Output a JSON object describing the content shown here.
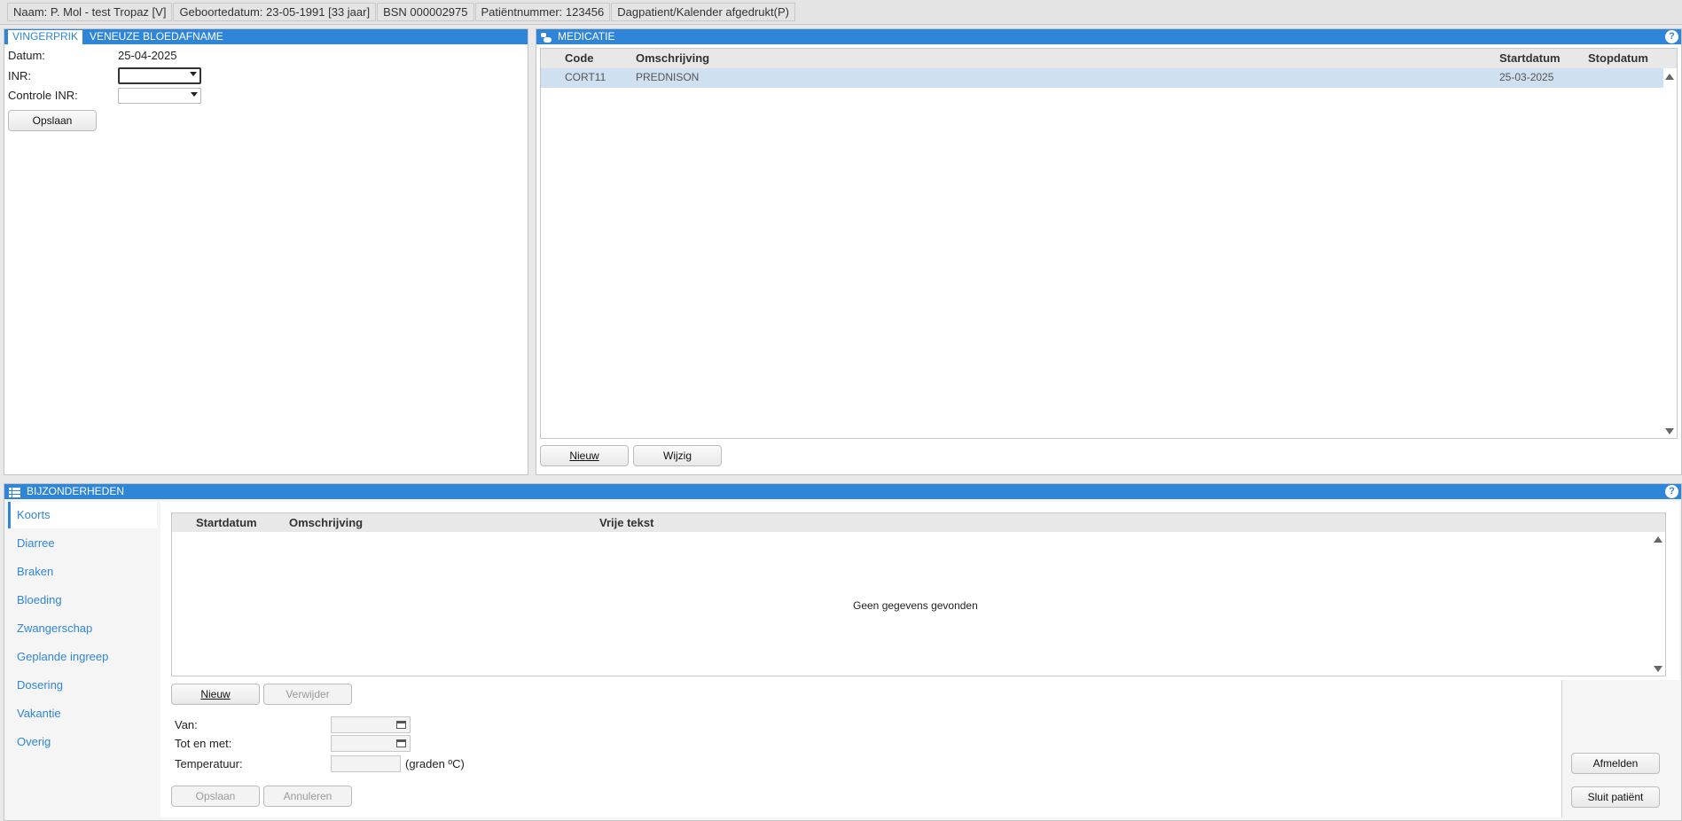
{
  "patient_bar": {
    "naam": "Naam: P. Mol - test Tropaz [V]",
    "geboortedatum": "Geboortedatum: 23-05-1991 [33 jaar]",
    "bsn": "BSN 000002975",
    "patientnummer": "Patiëntnummer: 123456",
    "type": "Dagpatient/Kalender afgedrukt(P)"
  },
  "inr_panel": {
    "tabs": [
      "VINGERPRIK",
      "VENEUZE BLOEDAFNAME"
    ],
    "active_tab": "VINGERPRIK",
    "datum_label": "Datum:",
    "datum_value": "25-04-2025",
    "inr_label": "INR:",
    "controle_label": "Controle INR:",
    "opslaan": "Opslaan"
  },
  "medicatie": {
    "title": "MEDICATIE",
    "columns": [
      "Code",
      "Omschrijving",
      "Startdatum",
      "Stopdatum"
    ],
    "rows": [
      {
        "code": "CORT11",
        "omschrijving": "PREDNISON",
        "startdatum": "25-03-2025",
        "stopdatum": ""
      }
    ],
    "nieuw": "Nieuw",
    "wijzig": "Wijzig"
  },
  "bijzonderheden": {
    "title": "BIJZONDERHEDEN",
    "side_items": [
      "Koorts",
      "Diarree",
      "Braken",
      "Bloeding",
      "Zwangerschap",
      "Geplande ingreep",
      "Dosering",
      "Vakantie",
      "Overig"
    ],
    "active_item": "Koorts",
    "columns": [
      "Startdatum",
      "Omschrijving",
      "Vrije tekst"
    ],
    "empty_text": "Geen gegevens gevonden",
    "nieuw": "Nieuw",
    "verwijder": "Verwijder",
    "van_label": "Van:",
    "tot_label": "Tot en met:",
    "temp_label": "Temperatuur:",
    "temp_unit": "(graden ºC)",
    "opslaan": "Opslaan",
    "annuleren": "Annuleren",
    "afmelden": "Afmelden",
    "sluit": "Sluit patiënt"
  }
}
